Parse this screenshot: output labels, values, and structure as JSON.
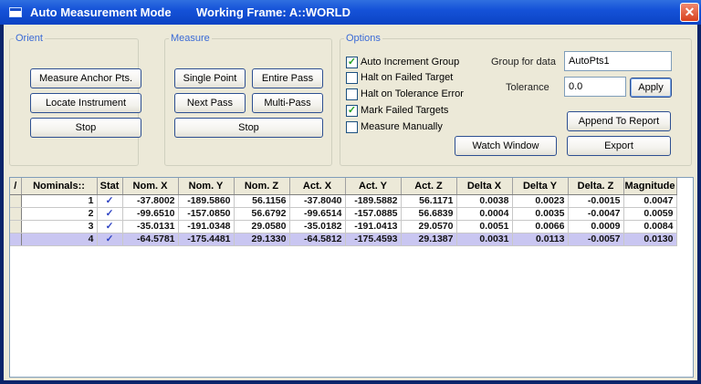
{
  "titlebar": {
    "title": "Auto Measurement Mode",
    "frame": "Working Frame:  A::WORLD",
    "close_glyph": "✕"
  },
  "orient": {
    "legend": "Orient",
    "measure_anchor_label": "Measure Anchor Pts.",
    "locate_instrument_label": "Locate Instrument",
    "stop_label": "Stop"
  },
  "measure": {
    "legend": "Measure",
    "single_point_label": "Single Point",
    "entire_pass_label": "Entire Pass",
    "next_pass_label": "Next Pass",
    "multi_pass_label": "Multi-Pass",
    "stop_label": "Stop"
  },
  "options": {
    "legend": "Options",
    "checks": [
      {
        "label": "Auto Increment Group",
        "checked": true
      },
      {
        "label": "Halt on Failed Target",
        "checked": false
      },
      {
        "label": "Halt on Tolerance Error",
        "checked": false
      },
      {
        "label": "Mark Failed Targets",
        "checked": true
      },
      {
        "label": "Measure Manually",
        "checked": false
      }
    ],
    "group_label": "Group for data",
    "group_value": "AutoPts1",
    "tolerance_label": "Tolerance",
    "tolerance_value": "0.0",
    "apply_label": "Apply",
    "append_label": "Append To Report",
    "watch_label": "Watch Window",
    "export_label": "Export"
  },
  "grid": {
    "columns": [
      "/",
      "Nominals::",
      "Stat",
      "Nom. X",
      "Nom. Y",
      "Nom. Z",
      "Act. X",
      "Act. Y",
      "Act. Z",
      "Delta X",
      "Delta Y",
      "Delta. Z",
      "Magnitude"
    ],
    "check_glyph": "✓",
    "rows": [
      {
        "nominal": "1",
        "nom_x": "-37.8002",
        "nom_y": "-189.5860",
        "nom_z": "56.1156",
        "act_x": "-37.8040",
        "act_y": "-189.5882",
        "act_z": "56.1171",
        "dx": "0.0038",
        "dy": "0.0023",
        "dz": "-0.0015",
        "mag": "0.0047"
      },
      {
        "nominal": "2",
        "nom_x": "-99.6510",
        "nom_y": "-157.0850",
        "nom_z": "56.6792",
        "act_x": "-99.6514",
        "act_y": "-157.0885",
        "act_z": "56.6839",
        "dx": "0.0004",
        "dy": "0.0035",
        "dz": "-0.0047",
        "mag": "0.0059"
      },
      {
        "nominal": "3",
        "nom_x": "-35.0131",
        "nom_y": "-191.0348",
        "nom_z": "29.0580",
        "act_x": "-35.0182",
        "act_y": "-191.0413",
        "act_z": "29.0570",
        "dx": "0.0051",
        "dy": "0.0066",
        "dz": "0.0009",
        "mag": "0.0084"
      },
      {
        "nominal": "4",
        "nom_x": "-64.5781",
        "nom_y": "-175.4481",
        "nom_z": "29.1330",
        "act_x": "-64.5812",
        "act_y": "-175.4593",
        "act_z": "29.1387",
        "dx": "0.0031",
        "dy": "0.0113",
        "dz": "-0.0057",
        "mag": "0.0130"
      }
    ]
  }
}
